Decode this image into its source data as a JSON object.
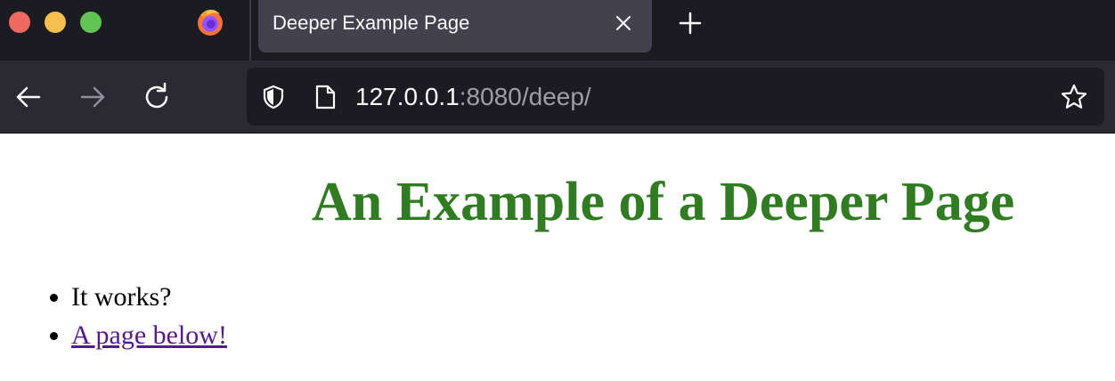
{
  "browser": {
    "tab": {
      "title": "Deeper Example Page"
    },
    "url": {
      "host": "127.0.0.1",
      "rest": ":8080/deep/"
    },
    "icons": {
      "logo": "firefox-logo-icon",
      "close": "close-icon",
      "new_tab": "plus-icon",
      "back": "arrow-left-icon",
      "forward": "arrow-right-icon",
      "reload": "reload-icon",
      "shield": "shield-icon",
      "page": "page-icon",
      "bookmark": "star-icon"
    },
    "colors": {
      "tabbar_bg": "#1c1b22",
      "navbar_bg": "#2b2a33",
      "active_tab_bg": "#42414d",
      "traffic_red": "#ed6a5e",
      "traffic_yellow": "#f5bf4f",
      "traffic_green": "#61c554"
    }
  },
  "page": {
    "heading": "An Example of a Deeper Page",
    "heading_color": "#317c23",
    "items": [
      {
        "text": "It works?"
      },
      {
        "link_text": "A page below!"
      }
    ],
    "link_color": "#551a8b"
  }
}
